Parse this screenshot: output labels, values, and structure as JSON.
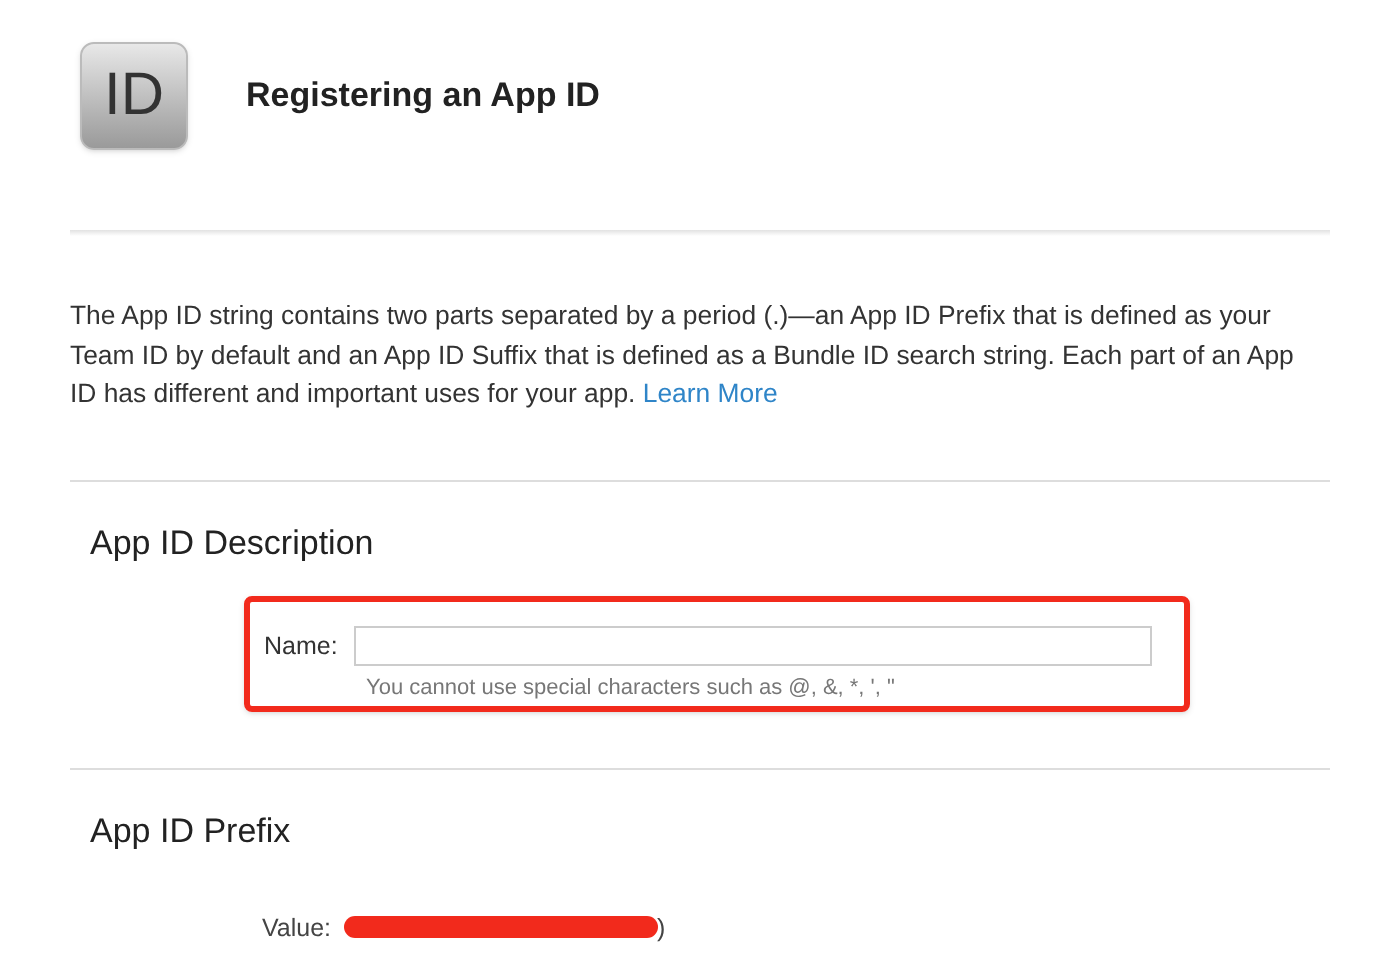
{
  "header": {
    "icon_text": "ID",
    "title": "Registering an App ID"
  },
  "intro": {
    "text": "The App ID string contains two parts separated by a period (.)—an App ID Prefix that is defined as your Team ID by default and an App ID Suffix that is defined as a Bundle ID search string. Each part of an App ID has different and important uses for your app.",
    "link": "Learn More"
  },
  "description_section": {
    "heading": "App ID Description",
    "name_label": "Name:",
    "name_placeholder_hint": "You cannot use special characters such as @, &, *, ', \"",
    "highlighted": true
  },
  "prefix_section": {
    "heading": "App ID Prefix",
    "value_label": "Value:",
    "value": ")",
    "redacted": true
  }
}
